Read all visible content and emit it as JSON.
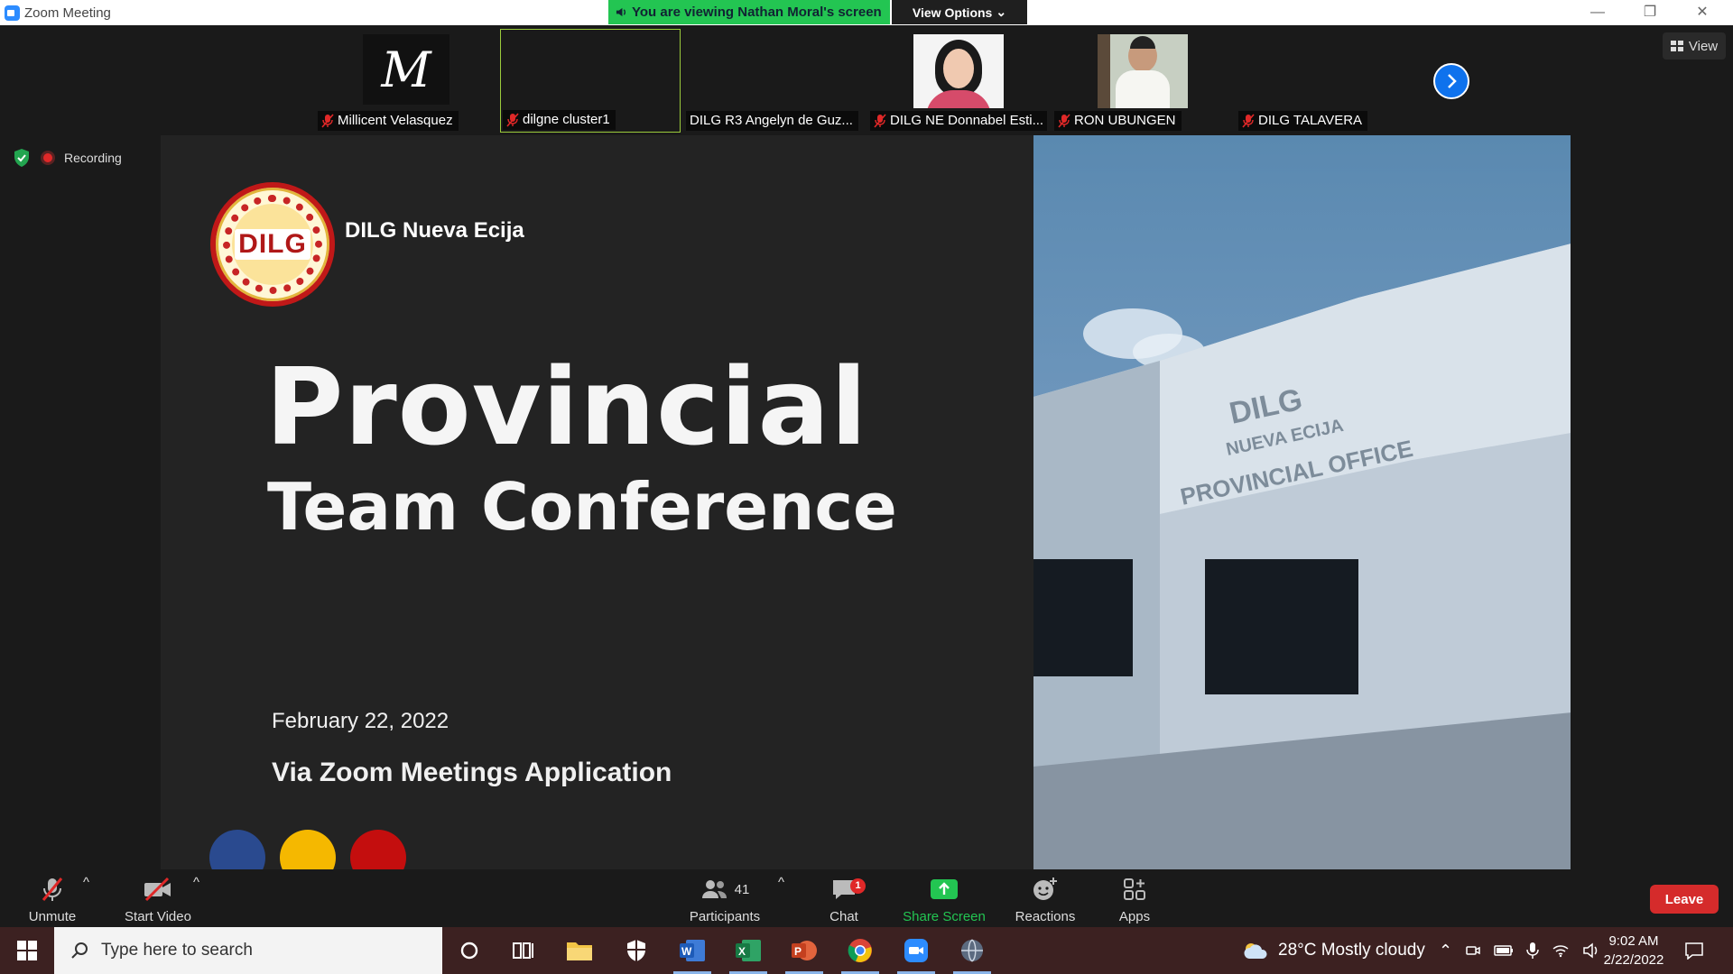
{
  "window": {
    "title": "Zoom Meeting",
    "viewing_banner": "You are viewing Nathan Moral's screen",
    "view_options": "View Options"
  },
  "thumbnails": [
    {
      "name": "Millicent Velasquez",
      "muted": true,
      "avatar": "M-signature-avatar"
    },
    {
      "name": "dilgne cluster1",
      "muted": true,
      "active": true
    },
    {
      "name": "DILG R3 Angelyn de Guz...",
      "muted": false
    },
    {
      "name": "DILG NE Donnabel Esti...",
      "muted": true,
      "avatar": "woman-photo"
    },
    {
      "name": "RON UBUNGEN",
      "muted": true,
      "avatar": "man-photo"
    },
    {
      "name": "DILG TALAVERA",
      "muted": true
    }
  ],
  "view_button": "View",
  "recording_label": "Recording",
  "slide": {
    "org_name": "DILG Nueva Ecija",
    "logo_text": "DILG",
    "title": "Provincial",
    "subtitle": "Team Conference",
    "date": "February 22, 2022",
    "via": "Via Zoom Meetings Application",
    "dot_colors": [
      "#2a4a8f",
      "#f5b800",
      "#c40e0e"
    ],
    "photo_sign": [
      "DILG",
      "NUEVA ECIJA",
      "PROVINCIAL OFFICE"
    ]
  },
  "toolbar": {
    "unmute": "Unmute",
    "start_video": "Start Video",
    "participants": "Participants",
    "participants_count": "41",
    "chat": "Chat",
    "chat_badge": "1",
    "share_screen": "Share Screen",
    "reactions": "Reactions",
    "apps": "Apps",
    "leave": "Leave"
  },
  "taskbar": {
    "search_placeholder": "Type here to search",
    "weather": "28°C  Mostly cloudy",
    "time": "9:02 AM",
    "date": "2/22/2022"
  },
  "colors": {
    "zoom_blue": "#0e72ed",
    "banner_green": "#23c552",
    "leave_red": "#d52b2b",
    "share_green": "#23c552"
  }
}
